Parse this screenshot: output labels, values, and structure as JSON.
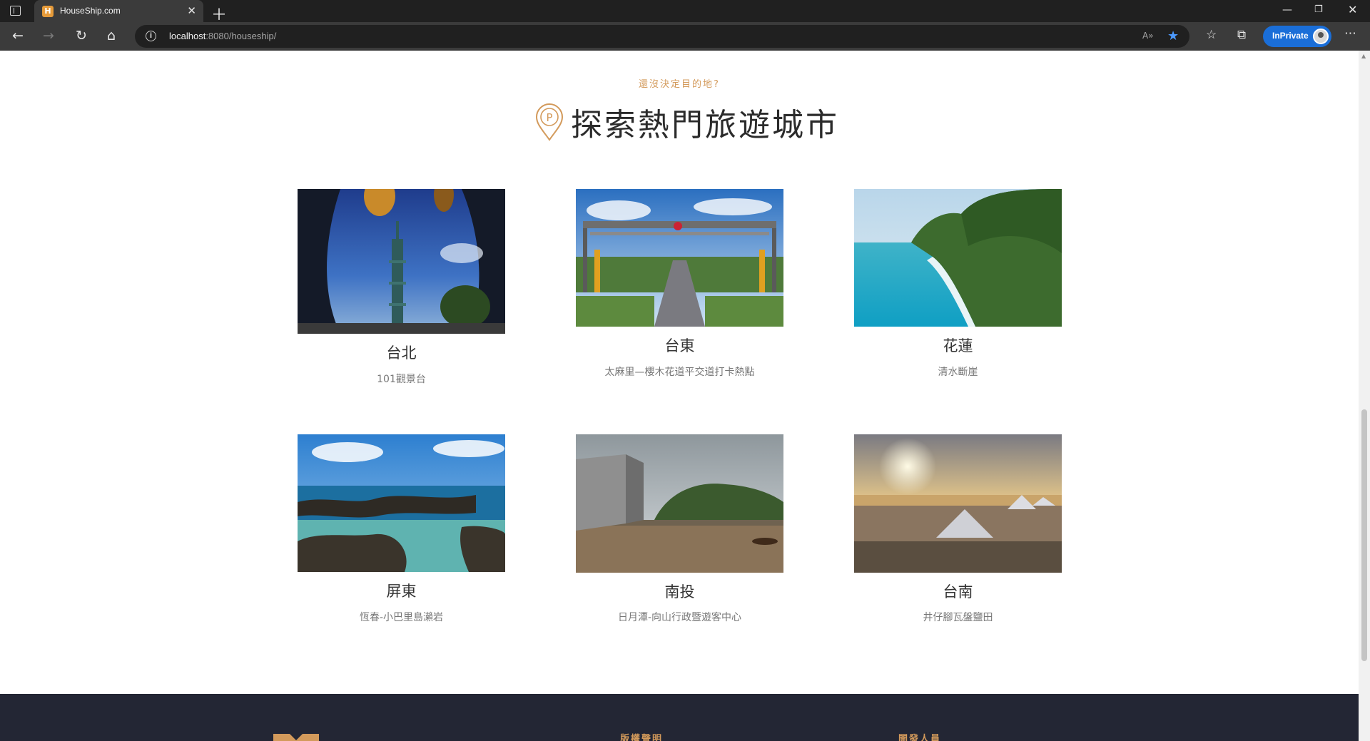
{
  "browser": {
    "tab_title": "HouseShip.com",
    "favicon_letter": "H",
    "url_host": "localhost",
    "url_rest": ":8080/houseship/",
    "inprivate_label": "InPrivate",
    "read_aloud": "A»"
  },
  "icons": {
    "window": "tab-actions-icon",
    "close_tab": "close-icon",
    "new_tab": "plus-icon",
    "back": "arrow-left-icon",
    "forward": "arrow-right-icon",
    "reload": "reload-icon",
    "home": "home-icon",
    "info": "info-icon",
    "favorite": "star-icon",
    "favorites": "favorites-icon",
    "collections": "collections-icon",
    "more": "more-icon",
    "location_pin": "location-pin-icon"
  },
  "glyphs": {
    "close": "✕",
    "plus": "＋",
    "back": "←",
    "forward": "→",
    "reload": "↻",
    "home": "⌂",
    "info": "i",
    "star": "★",
    "favorites": "☆",
    "collections": "⧉",
    "more": "⋯",
    "minimize": "—",
    "maximize": "❐",
    "win_close": "✕",
    "scroll_up": "▲"
  },
  "section": {
    "subtitle": "還沒決定目的地?",
    "title": "探索熱門旅遊城市"
  },
  "cities": [
    {
      "name": "台北",
      "desc": "101觀景台"
    },
    {
      "name": "台東",
      "desc": "太麻里—櫻木花道平交道打卡熱點"
    },
    {
      "name": "花蓮",
      "desc": "清水斷崖"
    },
    {
      "name": "屏東",
      "desc": "恆春-小巴里島瀨岩"
    },
    {
      "name": "南投",
      "desc": "日月潭-向山行政暨遊客中心"
    },
    {
      "name": "台南",
      "desc": "井仔腳瓦盤鹽田"
    }
  ],
  "footer": {
    "copyright_heading": "版權聲明",
    "developers_heading": "開發人員"
  },
  "colors": {
    "accent": "#d39a5b",
    "footer_bg": "#232634",
    "inprivate_blue": "#1a6ed8"
  }
}
